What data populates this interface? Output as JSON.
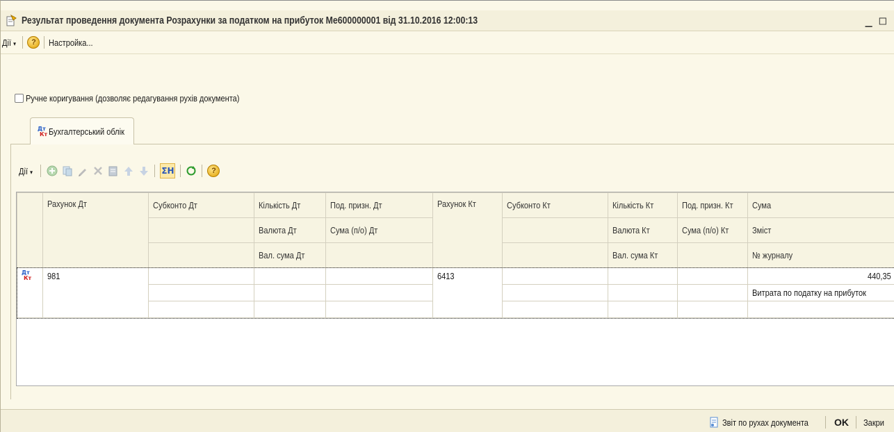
{
  "window": {
    "title": "Результат проведення документа Розрахунки за податком на прибуток Ме600000001 від 31.10.2016 12:00:13",
    "minimize": "_",
    "maximize": "□"
  },
  "toolbar": {
    "actions_label": "Дії",
    "help_label": "?",
    "settings_label": "Настройка..."
  },
  "manual_edit": {
    "label": "Ручне коригування (дозволяє редагування рухів документа)",
    "checked": false
  },
  "tab": {
    "icon_dt": "Дт",
    "icon_kt": "Кт",
    "label": "Бухгалтерський облік"
  },
  "grid_toolbar": {
    "actions_label": "Дії",
    "icons": [
      "add-icon",
      "copy-icon",
      "edit-icon",
      "delete-icon",
      "post-icon",
      "move-up-icon",
      "move-down-icon",
      "sum-icon",
      "refresh-icon",
      "help-icon"
    ],
    "sum_label": "ΣН",
    "help_label": "?"
  },
  "columns": {
    "row1": [
      "Рахунок Дт",
      "Субконто Дт",
      "Кількість Дт",
      "Под. призн. Дт",
      "Рахунок Кт",
      "Субконто Кт",
      "Кількість Кт",
      "Под. призн. Кт",
      "Сума"
    ],
    "row2": [
      "Валюта Дт",
      "Сума (п/о) Дт",
      "Валюта Кт",
      "Сума (п/о) Кт",
      "Зміст"
    ],
    "row3": [
      "Вал. сума Дт",
      "Вал. сума Кт",
      "№ журналу"
    ]
  },
  "rows": [
    {
      "account_dt": "981",
      "account_kt": "6413",
      "amount": "440,35",
      "content": "Витрата по податку на прибуток"
    }
  ],
  "footer": {
    "report_label": "Звіт по рухах документа",
    "ok_label": "OK",
    "close_label": "Закри"
  }
}
